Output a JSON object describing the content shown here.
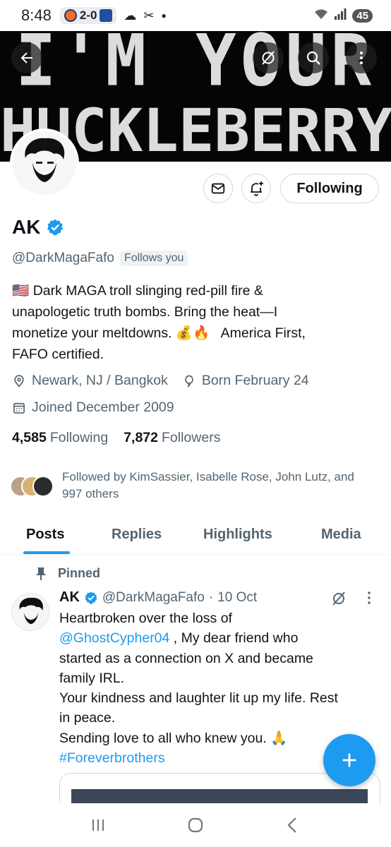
{
  "status_bar": {
    "time": "8:48",
    "score": "2-0",
    "battery": "45"
  },
  "banner": {
    "line1": "I'M YOUR",
    "line2": "HUCKLEBERRY"
  },
  "header_icons": [
    "back-arrow-icon",
    "grok-icon",
    "search-icon",
    "more-vertical-icon"
  ],
  "profile": {
    "follow_button": "Following",
    "name": "AK",
    "handle": "@DarkMagaFafo",
    "follows_you": "Follows you",
    "bio": {
      "l1": "🇺🇸 Dark MAGA troll slinging red-pill fire &",
      "l2": "unapologetic truth bombs. Bring the heat—I",
      "l3": "monetize your meltdowns. 💰🔥   America First,",
      "l4": "FAFO certified."
    },
    "location": "Newark, NJ / Bangkok",
    "birthday": "Born February 24",
    "joined": "Joined December 2009",
    "following_count": "4,585",
    "following_label": "Following",
    "followers_count": "7,872",
    "followers_label": "Followers",
    "followed_by": "Followed by KimSassier, Isabelle Rose, John Lutz, and 997 others"
  },
  "tabs": [
    {
      "label": "Posts"
    },
    {
      "label": "Replies"
    },
    {
      "label": "Highlights"
    },
    {
      "label": "Media"
    }
  ],
  "post": {
    "pinned_label": "Pinned",
    "name": "AK",
    "handle": "@DarkMagaFafo",
    "separator": "·",
    "date": "10 Oct",
    "text": {
      "l1": "Heartbroken over the loss of",
      "mention": "@GhostCypher04",
      "l2_rest": " , My dear friend who",
      "l3": "started as a connection on X and became",
      "l4": "family IRL.",
      "l5": "Your kindness and laughter lit up my life. Rest",
      "l6": "in peace.",
      "l7": "Sending love to all who knew you. 🙏",
      "hashtag": "#Foreverbrothers"
    }
  },
  "colors": {
    "accent": "#1d9bf0",
    "text": "#0f1419",
    "muted": "#536471"
  }
}
